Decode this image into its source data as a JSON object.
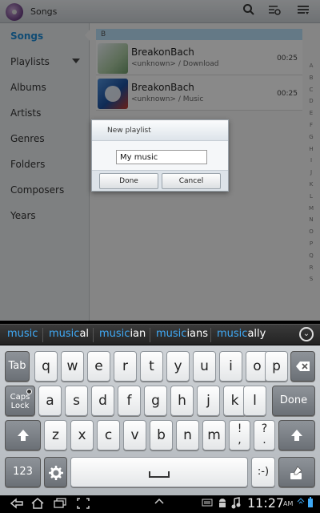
{
  "app": {
    "title": "Songs"
  },
  "sidebar": {
    "items": [
      {
        "label": "Songs"
      },
      {
        "label": "Playlists"
      },
      {
        "label": "Albums"
      },
      {
        "label": "Artists"
      },
      {
        "label": "Genres"
      },
      {
        "label": "Folders"
      },
      {
        "label": "Composers"
      },
      {
        "label": "Years"
      }
    ]
  },
  "list": {
    "section": "B",
    "rows": [
      {
        "title": "BreakonBach",
        "subtitle": "<unknown> / Download",
        "duration": "00:25"
      },
      {
        "title": "BreakonBach",
        "subtitle": "<unknown> / Music",
        "duration": "00:25"
      }
    ],
    "index": [
      "A",
      "B",
      "C",
      "D",
      "E",
      "F",
      "G",
      "H",
      "I",
      "J",
      "K",
      "L",
      "M",
      "N",
      "O",
      "P",
      "Q",
      "R",
      "S"
    ]
  },
  "dialog": {
    "title": "New playlist",
    "input_value": "My music",
    "done_label": "Done",
    "cancel_label": "Cancel"
  },
  "suggestions": [
    {
      "hl": "music",
      "rest": ""
    },
    {
      "hl": "music",
      "rest": "al"
    },
    {
      "hl": "music",
      "rest": "ian"
    },
    {
      "hl": "music",
      "rest": "ians"
    },
    {
      "hl": "music",
      "rest": "ally"
    }
  ],
  "keyboard": {
    "row1": [
      "q",
      "w",
      "e",
      "r",
      "t",
      "y",
      "u",
      "i",
      "o",
      "p"
    ],
    "row2": [
      "a",
      "s",
      "d",
      "f",
      "g",
      "h",
      "j",
      "k",
      "l"
    ],
    "row3": [
      "z",
      "x",
      "c",
      "v",
      "b",
      "n",
      "m"
    ],
    "tab": "Tab",
    "caps": "Caps Lock",
    "done": "Done",
    "num": "123",
    "smiley": ":-)",
    "punct1": "!\n,",
    "punct2": "?\n."
  },
  "statusbar": {
    "time": "11:27",
    "ampm": "AM"
  }
}
